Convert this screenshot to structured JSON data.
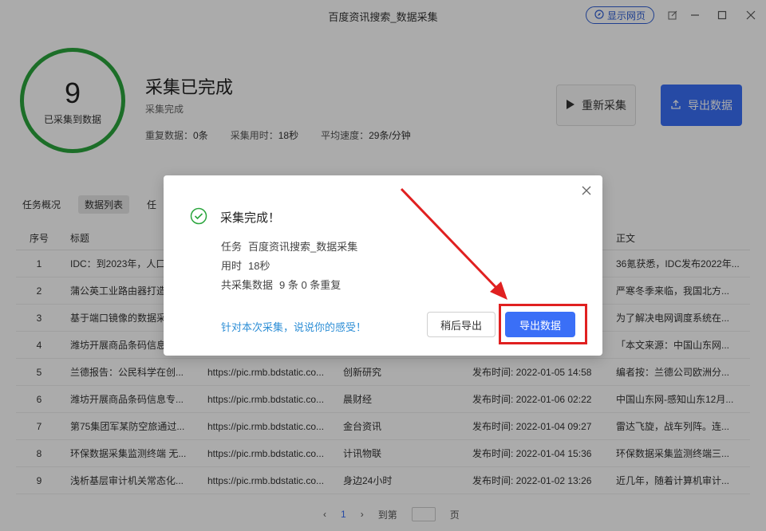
{
  "window": {
    "title": "百度资讯搜索_数据采集",
    "show_web_label": "显示网页"
  },
  "summary": {
    "count": "9",
    "count_label": "已采集到数据",
    "status_title": "采集已完成",
    "status_sub": "采集完成",
    "stats": [
      {
        "label": "重复数据：",
        "value": "0条"
      },
      {
        "label": "采集用时：",
        "value": "18秒"
      },
      {
        "label": "平均速度：",
        "value": "29条/分钟"
      }
    ],
    "restart_label": "重新采集",
    "export_label": "导出数据"
  },
  "tabs": [
    "任务概况",
    "数据列表",
    "任"
  ],
  "table": {
    "headers": {
      "idx": "序号",
      "title": "标题",
      "url": "",
      "source": "",
      "time": "",
      "body": "正文"
    },
    "rows": [
      {
        "idx": "1",
        "title": "IDC：到2023年，人口",
        "url": "",
        "source": "",
        "time": "",
        "body": "36氪获悉，IDC发布2022年..."
      },
      {
        "idx": "2",
        "title": "蒲公英工业路由器打造",
        "url": "",
        "source": "",
        "time": "",
        "body": "严寒冬季来临，我国北方..."
      },
      {
        "idx": "3",
        "title": "基于端口镜像的数据采",
        "url": "",
        "source": "",
        "time": "",
        "body": "为了解决电网调度系统在..."
      },
      {
        "idx": "4",
        "title": "潍坊开展商品条码信息",
        "url": "",
        "source": "",
        "time": "",
        "body": "「本文来源：中国山东网..."
      },
      {
        "idx": "5",
        "title": "兰德报告：公民科学在创...",
        "url": "https://pic.rmb.bdstatic.co...",
        "source": "创新研究",
        "time": "发布时间: 2022-01-05 14:58",
        "body": "编者按：兰德公司欧洲分..."
      },
      {
        "idx": "6",
        "title": "潍坊开展商品条码信息专...",
        "url": "https://pic.rmb.bdstatic.co...",
        "source": "晨财经",
        "time": "发布时间: 2022-01-06 02:22",
        "body": "中国山东网-感知山东12月..."
      },
      {
        "idx": "7",
        "title": "第75集团军某防空旅通过...",
        "url": "https://pic.rmb.bdstatic.co...",
        "source": "金台资讯",
        "time": "发布时间: 2022-01-04 09:27",
        "body": "雷达飞旋，战车列阵。连..."
      },
      {
        "idx": "8",
        "title": "环保数据采集监测终端 无...",
        "url": "https://pic.rmb.bdstatic.co...",
        "source": "计讯物联",
        "time": "发布时间: 2022-01-04 15:36",
        "body": "环保数据采集监测终端三..."
      },
      {
        "idx": "9",
        "title": "浅析基层审计机关常态化...",
        "url": "https://pic.rmb.bdstatic.co...",
        "source": "身边24小时",
        "time": "发布时间: 2022-01-02 13:26",
        "body": "近几年，随着计算机审计..."
      }
    ]
  },
  "pager": {
    "current": "1",
    "goto_prefix": "到第",
    "goto_suffix": "页"
  },
  "modal": {
    "title": "采集完成！",
    "task_label": "任务",
    "task_value": "百度资讯搜索_数据采集",
    "time_label": "用时",
    "time_value": "18秒",
    "total_label": "共采集数据",
    "total_value": "9 条 0 条重复",
    "feedback_link": "针对本次采集，说说你的感受！",
    "later_label": "稍后导出",
    "export_label": "导出数据"
  },
  "colors": {
    "accent": "#3a6ff7",
    "success": "#2aa53d",
    "annotation": "#e02020",
    "link": "#2f8fd6"
  }
}
